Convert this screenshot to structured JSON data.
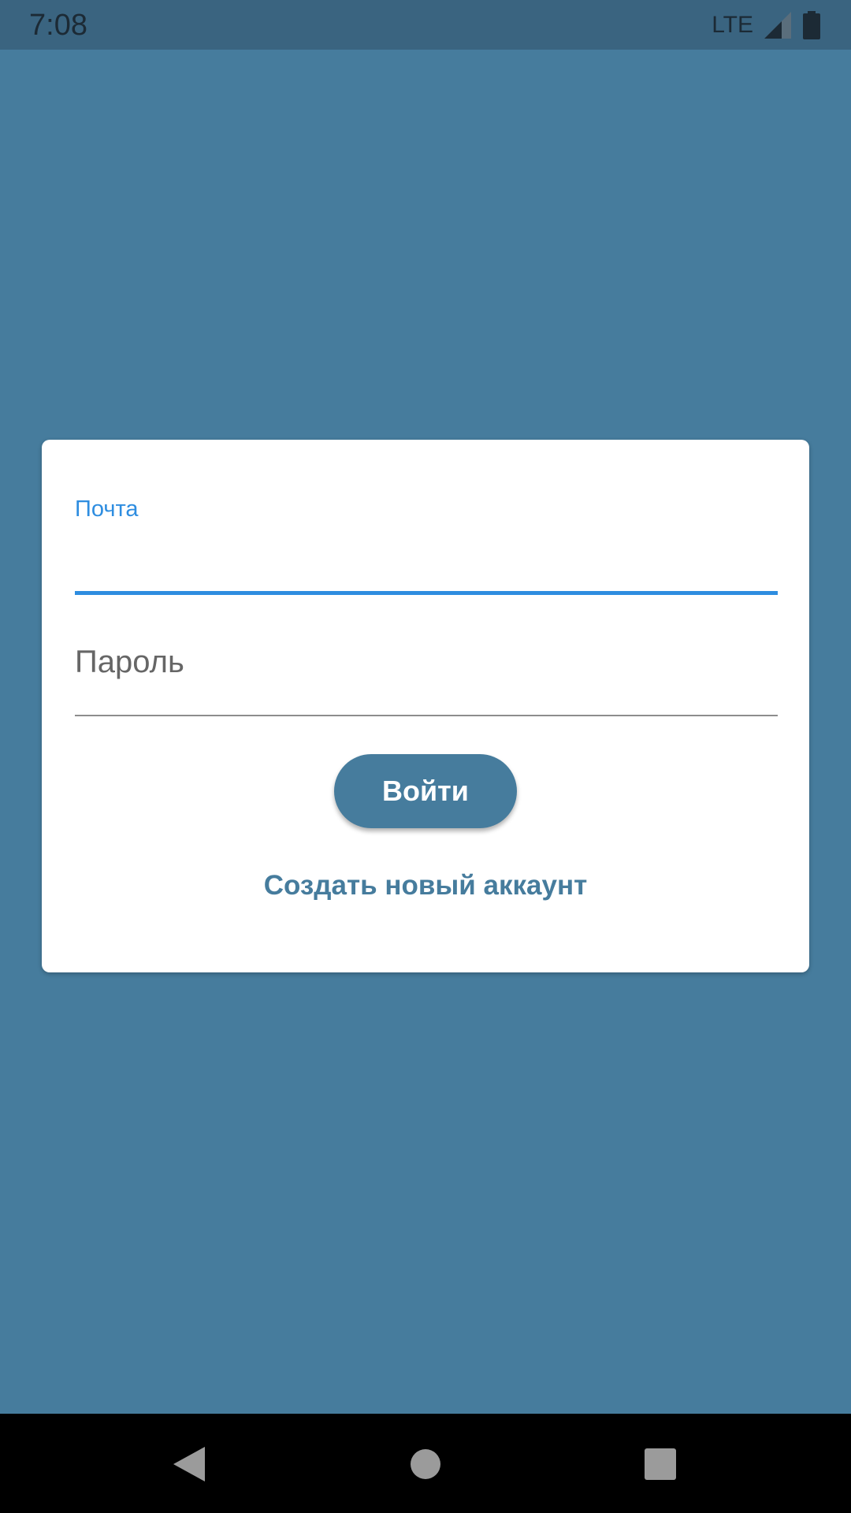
{
  "status_bar": {
    "time": "7:08",
    "network": "LTE",
    "icons": [
      "signal-icon",
      "battery-icon"
    ]
  },
  "login_form": {
    "email_label": "Почта",
    "email_value": "",
    "password_placeholder": "Пароль",
    "password_value": "",
    "login_button_label": "Войти",
    "create_account_label": "Создать новый аккаунт"
  },
  "nav_bar": {
    "icons": [
      "back-icon",
      "home-icon",
      "recents-icon"
    ]
  },
  "colors": {
    "background": "#467c9d",
    "status_bar": "#3a6480",
    "accent_blue": "#2e8de0",
    "button": "#467c9d",
    "card": "#ffffff",
    "nav_bar": "#000000"
  }
}
